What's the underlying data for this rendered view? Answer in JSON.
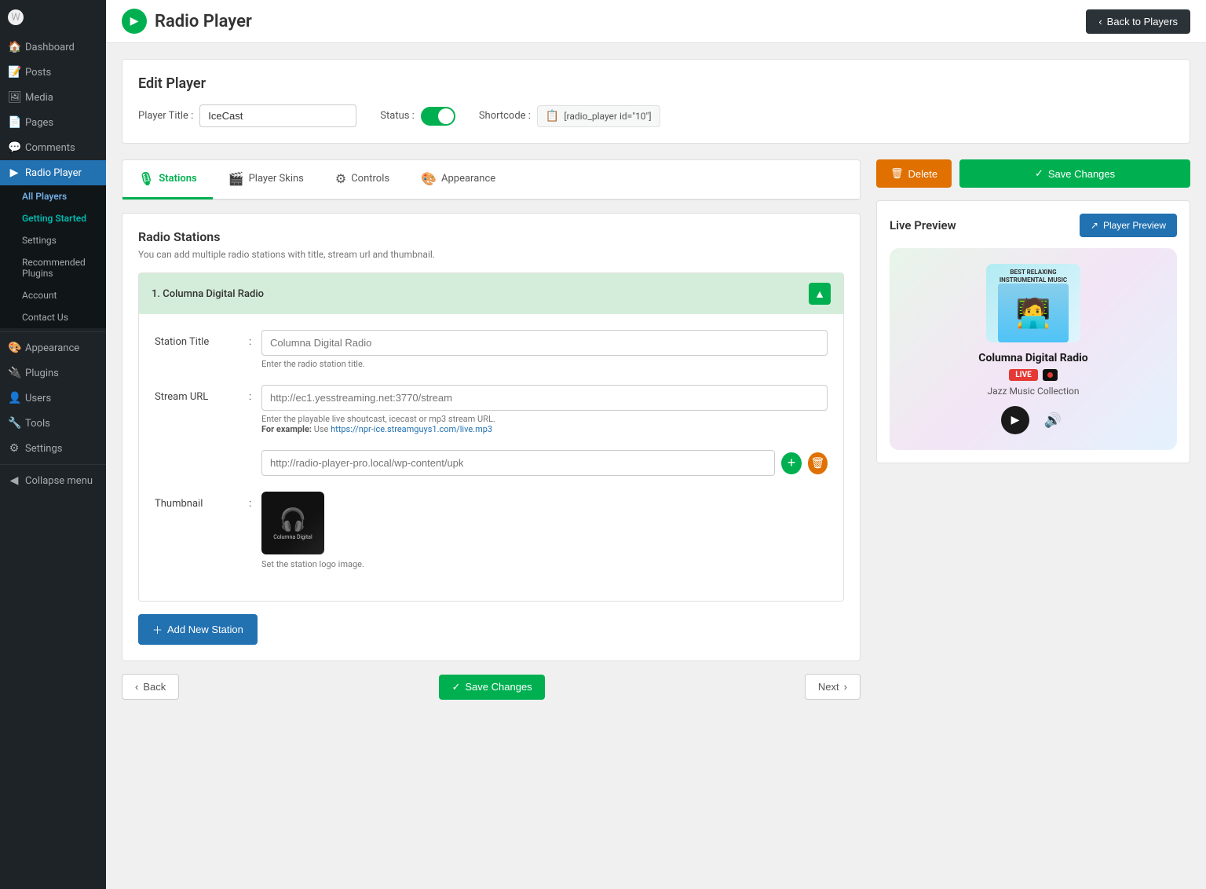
{
  "sidebar": {
    "logo": "W",
    "items": [
      {
        "id": "dashboard",
        "label": "Dashboard",
        "icon": "🏠"
      },
      {
        "id": "posts",
        "label": "Posts",
        "icon": "📝"
      },
      {
        "id": "media",
        "label": "Media",
        "icon": "🖼"
      },
      {
        "id": "pages",
        "label": "Pages",
        "icon": "📄"
      },
      {
        "id": "comments",
        "label": "Comments",
        "icon": "💬"
      },
      {
        "id": "radio-player",
        "label": "Radio Player",
        "icon": "▶"
      }
    ],
    "submenu": [
      {
        "id": "all-players",
        "label": "All Players"
      },
      {
        "id": "getting-started",
        "label": "Getting Started"
      },
      {
        "id": "settings",
        "label": "Settings"
      },
      {
        "id": "recommended-plugins",
        "label": "Recommended Plugins"
      },
      {
        "id": "account",
        "label": "Account"
      },
      {
        "id": "contact-us",
        "label": "Contact Us"
      }
    ],
    "bottom_items": [
      {
        "id": "appearance",
        "label": "Appearance",
        "icon": "🎨"
      },
      {
        "id": "plugins",
        "label": "Plugins",
        "icon": "🔌"
      },
      {
        "id": "users",
        "label": "Users",
        "icon": "👤"
      },
      {
        "id": "tools",
        "label": "Tools",
        "icon": "🔧"
      },
      {
        "id": "settings",
        "label": "Settings",
        "icon": "⚙"
      },
      {
        "id": "collapse",
        "label": "Collapse menu",
        "icon": "◀"
      }
    ]
  },
  "topbar": {
    "title": "Radio Player",
    "back_button": "Back to Players"
  },
  "edit_player": {
    "section_title": "Edit Player",
    "player_title_label": "Player Title :",
    "player_title_value": "IceCast",
    "player_title_placeholder": "IceCast",
    "status_label": "Status :",
    "status_on": true,
    "shortcode_label": "Shortcode :",
    "shortcode_value": "[radio_player id=\"10\"]"
  },
  "tabs": [
    {
      "id": "stations",
      "label": "Stations",
      "icon": "🎙",
      "active": true
    },
    {
      "id": "player-skins",
      "label": "Player Skins",
      "icon": "🎬"
    },
    {
      "id": "controls",
      "label": "Controls",
      "icon": "⚙"
    },
    {
      "id": "appearance",
      "label": "Appearance",
      "icon": "🎨"
    }
  ],
  "stations": {
    "section_title": "Radio Stations",
    "description": "You can add multiple radio stations with title, stream url and thumbnail.",
    "station": {
      "number": "1",
      "name": "Columna Digital Radio",
      "header_label": "1. Columna Digital Radio",
      "fields": {
        "station_title_label": "Station Title",
        "station_title_value": "Columna Digital Radio",
        "station_title_placeholder": "Columna Digital Radio",
        "station_title_hint": "Enter the radio station title.",
        "stream_url_label": "Stream URL",
        "stream_url_value": "http://ec1.yesstreaming.net:3770/stream",
        "stream_url_placeholder": "http://ec1.yesstreaming.net:3770/stream",
        "stream_url_hint": "Enter the playable live shoutcast, icecast or mp3 stream URL.",
        "stream_url_example_prefix": "For example:",
        "stream_url_example_text": "Use",
        "stream_url_example_link": "https://npr-ice.streamguys1.com/live.mp3",
        "thumbnail_label": "Thumbnail",
        "thumbnail_url": "http://radio-player-pro.local/wp-content/upk",
        "thumbnail_hint": "Set the station logo image."
      }
    },
    "add_station_label": "Add New Station"
  },
  "actions": {
    "delete_label": "Delete",
    "save_changes_label": "Save Changes"
  },
  "live_preview": {
    "title": "Live Preview",
    "preview_btn": "Player Preview",
    "player": {
      "station_name": "Columna Digital Radio",
      "album_text": "BEST RELAXING INSTRUMENTAL MUSIC",
      "badge_live": "LIVE",
      "track": "Jazz Music Collection"
    }
  },
  "bottom_nav": {
    "back_label": "Back",
    "save_label": "Save Changes",
    "next_label": "Next"
  }
}
